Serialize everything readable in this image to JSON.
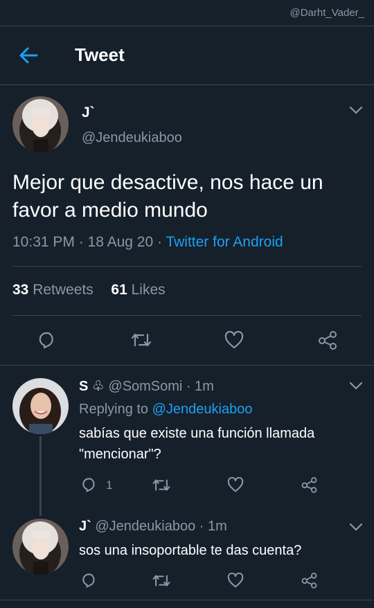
{
  "watermark": "@Darht_Vader_",
  "header": {
    "title": "Tweet"
  },
  "tweet": {
    "name": "J`",
    "handle": "@Jendeukiaboo",
    "text": "Mejor que desactive, nos hace un favor a medio mundo",
    "time": "10:31 PM · 18 Aug 20 · ",
    "source": "Twitter for Android",
    "retweets_count": "33",
    "retweets_label": " Retweets",
    "likes_count": "61",
    "likes_label": " Likes"
  },
  "replies": [
    {
      "name": "S ♧",
      "handle_time": " @SomSomi · 1m",
      "replying_label": "Replying to ",
      "replying_handle": "@Jendeukiaboo",
      "text": "sabías que existe una función llamada \"mencionar\"?",
      "reply_count": "1"
    },
    {
      "name": "J`",
      "handle_time": " @Jendeukiaboo · 1m",
      "text": "sos una insoportable te das cuenta?"
    }
  ],
  "icons": {
    "back": "arrow-left-icon",
    "chevron": "chevron-down-icon",
    "reply": "reply-icon",
    "retweet": "retweet-icon",
    "like": "heart-icon",
    "share": "share-icon"
  },
  "colors": {
    "background": "#15202b",
    "divider": "#38444d",
    "secondary_text": "#8899a6",
    "accent": "#1da1f2"
  }
}
